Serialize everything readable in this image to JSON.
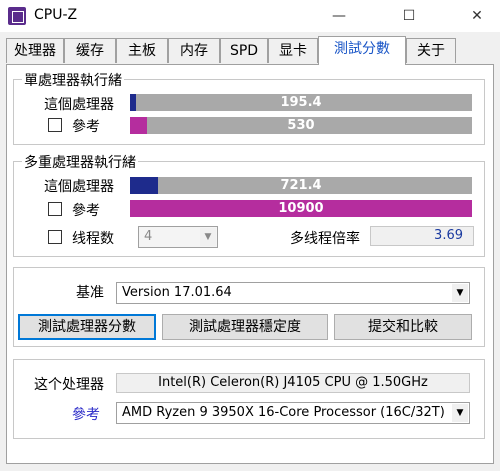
{
  "window": {
    "title": "CPU-Z",
    "minimize_glyph": "—",
    "maximize_glyph": "☐",
    "close_glyph": "✕"
  },
  "tabs": [
    {
      "label": "处理器"
    },
    {
      "label": "缓存"
    },
    {
      "label": "主板"
    },
    {
      "label": "内存"
    },
    {
      "label": "SPD"
    },
    {
      "label": "显卡"
    },
    {
      "label": "測試分數"
    },
    {
      "label": "关于"
    }
  ],
  "single_thread": {
    "title": "單處理器執行緒",
    "this_cpu_label": "這個處理器",
    "this_cpu_value": "195.4",
    "this_cpu_fill": 0.019,
    "reference_label": "參考",
    "reference_value": "530",
    "reference_fill": 0.049
  },
  "multi_thread": {
    "title": "多重處理器執行緒",
    "this_cpu_label": "這個處理器",
    "this_cpu_value": "721.4",
    "this_cpu_fill": 0.081,
    "reference_label": "參考",
    "reference_value": "10900",
    "reference_fill": 1.0,
    "threads_label": "线程数",
    "threads_value": "4",
    "ratio_label": "多线程倍率",
    "ratio_value": "3.69"
  },
  "benchmark": {
    "base_label": "基准",
    "version_value": "Version 17.01.64",
    "bench_cpu_button": "測試處理器分數",
    "stress_cpu_button": "測試處理器穩定度",
    "submit_button": "提交和比較"
  },
  "processor": {
    "this_label": "这个处理器",
    "this_value": "Intel(R) Celeron(R) J4105 CPU @ 1.50GHz",
    "reference_label": "參考",
    "reference_value": "AMD Ryzen 9 3950X 16-Core Processor (16C/32T)"
  },
  "colors": {
    "this_cpu_bar": "#1e2b8c",
    "reference_bar": "#b52d9e",
    "bar_track": "#a9a9a9",
    "active_tab_text": "#1a56c7",
    "reference_link": "#2a2ac8"
  }
}
